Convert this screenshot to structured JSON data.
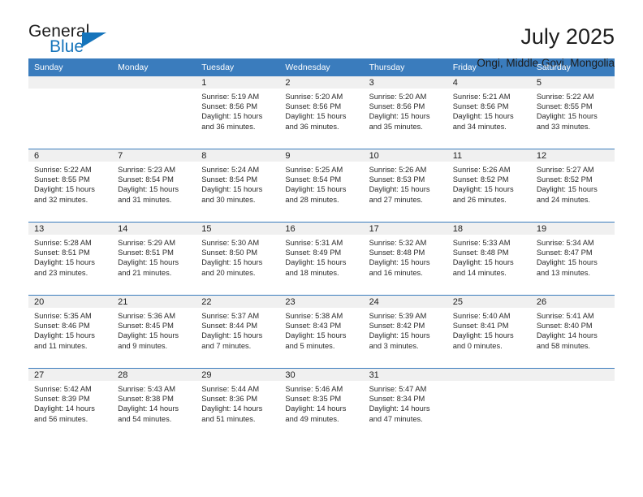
{
  "brand": {
    "name_part1": "General",
    "name_part2": "Blue"
  },
  "header": {
    "title": "July 2025",
    "subtitle": "Ongi, Middle Govi, Mongolia"
  },
  "calendar": {
    "weekday_headers": [
      "Sunday",
      "Monday",
      "Tuesday",
      "Wednesday",
      "Thursday",
      "Friday",
      "Saturday"
    ],
    "accent_color": "#3a7cbd",
    "daynum_band_color": "#f0f0f0",
    "labels": {
      "sunrise_prefix": "Sunrise: ",
      "sunset_prefix": "Sunset: ",
      "daylight_prefix": "Daylight: "
    },
    "weeks": [
      [
        {
          "day": "",
          "empty": true
        },
        {
          "day": "",
          "empty": true
        },
        {
          "day": "1",
          "sunrise": "Sunrise: 5:19 AM",
          "sunset": "Sunset: 8:56 PM",
          "daylight_l1": "Daylight: 15 hours",
          "daylight_l2": "and 36 minutes."
        },
        {
          "day": "2",
          "sunrise": "Sunrise: 5:20 AM",
          "sunset": "Sunset: 8:56 PM",
          "daylight_l1": "Daylight: 15 hours",
          "daylight_l2": "and 36 minutes."
        },
        {
          "day": "3",
          "sunrise": "Sunrise: 5:20 AM",
          "sunset": "Sunset: 8:56 PM",
          "daylight_l1": "Daylight: 15 hours",
          "daylight_l2": "and 35 minutes."
        },
        {
          "day": "4",
          "sunrise": "Sunrise: 5:21 AM",
          "sunset": "Sunset: 8:56 PM",
          "daylight_l1": "Daylight: 15 hours",
          "daylight_l2": "and 34 minutes."
        },
        {
          "day": "5",
          "sunrise": "Sunrise: 5:22 AM",
          "sunset": "Sunset: 8:55 PM",
          "daylight_l1": "Daylight: 15 hours",
          "daylight_l2": "and 33 minutes."
        }
      ],
      [
        {
          "day": "6",
          "sunrise": "Sunrise: 5:22 AM",
          "sunset": "Sunset: 8:55 PM",
          "daylight_l1": "Daylight: 15 hours",
          "daylight_l2": "and 32 minutes."
        },
        {
          "day": "7",
          "sunrise": "Sunrise: 5:23 AM",
          "sunset": "Sunset: 8:54 PM",
          "daylight_l1": "Daylight: 15 hours",
          "daylight_l2": "and 31 minutes."
        },
        {
          "day": "8",
          "sunrise": "Sunrise: 5:24 AM",
          "sunset": "Sunset: 8:54 PM",
          "daylight_l1": "Daylight: 15 hours",
          "daylight_l2": "and 30 minutes."
        },
        {
          "day": "9",
          "sunrise": "Sunrise: 5:25 AM",
          "sunset": "Sunset: 8:54 PM",
          "daylight_l1": "Daylight: 15 hours",
          "daylight_l2": "and 28 minutes."
        },
        {
          "day": "10",
          "sunrise": "Sunrise: 5:26 AM",
          "sunset": "Sunset: 8:53 PM",
          "daylight_l1": "Daylight: 15 hours",
          "daylight_l2": "and 27 minutes."
        },
        {
          "day": "11",
          "sunrise": "Sunrise: 5:26 AM",
          "sunset": "Sunset: 8:52 PM",
          "daylight_l1": "Daylight: 15 hours",
          "daylight_l2": "and 26 minutes."
        },
        {
          "day": "12",
          "sunrise": "Sunrise: 5:27 AM",
          "sunset": "Sunset: 8:52 PM",
          "daylight_l1": "Daylight: 15 hours",
          "daylight_l2": "and 24 minutes."
        }
      ],
      [
        {
          "day": "13",
          "sunrise": "Sunrise: 5:28 AM",
          "sunset": "Sunset: 8:51 PM",
          "daylight_l1": "Daylight: 15 hours",
          "daylight_l2": "and 23 minutes."
        },
        {
          "day": "14",
          "sunrise": "Sunrise: 5:29 AM",
          "sunset": "Sunset: 8:51 PM",
          "daylight_l1": "Daylight: 15 hours",
          "daylight_l2": "and 21 minutes."
        },
        {
          "day": "15",
          "sunrise": "Sunrise: 5:30 AM",
          "sunset": "Sunset: 8:50 PM",
          "daylight_l1": "Daylight: 15 hours",
          "daylight_l2": "and 20 minutes."
        },
        {
          "day": "16",
          "sunrise": "Sunrise: 5:31 AM",
          "sunset": "Sunset: 8:49 PM",
          "daylight_l1": "Daylight: 15 hours",
          "daylight_l2": "and 18 minutes."
        },
        {
          "day": "17",
          "sunrise": "Sunrise: 5:32 AM",
          "sunset": "Sunset: 8:48 PM",
          "daylight_l1": "Daylight: 15 hours",
          "daylight_l2": "and 16 minutes."
        },
        {
          "day": "18",
          "sunrise": "Sunrise: 5:33 AM",
          "sunset": "Sunset: 8:48 PM",
          "daylight_l1": "Daylight: 15 hours",
          "daylight_l2": "and 14 minutes."
        },
        {
          "day": "19",
          "sunrise": "Sunrise: 5:34 AM",
          "sunset": "Sunset: 8:47 PM",
          "daylight_l1": "Daylight: 15 hours",
          "daylight_l2": "and 13 minutes."
        }
      ],
      [
        {
          "day": "20",
          "sunrise": "Sunrise: 5:35 AM",
          "sunset": "Sunset: 8:46 PM",
          "daylight_l1": "Daylight: 15 hours",
          "daylight_l2": "and 11 minutes."
        },
        {
          "day": "21",
          "sunrise": "Sunrise: 5:36 AM",
          "sunset": "Sunset: 8:45 PM",
          "daylight_l1": "Daylight: 15 hours",
          "daylight_l2": "and 9 minutes."
        },
        {
          "day": "22",
          "sunrise": "Sunrise: 5:37 AM",
          "sunset": "Sunset: 8:44 PM",
          "daylight_l1": "Daylight: 15 hours",
          "daylight_l2": "and 7 minutes."
        },
        {
          "day": "23",
          "sunrise": "Sunrise: 5:38 AM",
          "sunset": "Sunset: 8:43 PM",
          "daylight_l1": "Daylight: 15 hours",
          "daylight_l2": "and 5 minutes."
        },
        {
          "day": "24",
          "sunrise": "Sunrise: 5:39 AM",
          "sunset": "Sunset: 8:42 PM",
          "daylight_l1": "Daylight: 15 hours",
          "daylight_l2": "and 3 minutes."
        },
        {
          "day": "25",
          "sunrise": "Sunrise: 5:40 AM",
          "sunset": "Sunset: 8:41 PM",
          "daylight_l1": "Daylight: 15 hours",
          "daylight_l2": "and 0 minutes."
        },
        {
          "day": "26",
          "sunrise": "Sunrise: 5:41 AM",
          "sunset": "Sunset: 8:40 PM",
          "daylight_l1": "Daylight: 14 hours",
          "daylight_l2": "and 58 minutes."
        }
      ],
      [
        {
          "day": "27",
          "sunrise": "Sunrise: 5:42 AM",
          "sunset": "Sunset: 8:39 PM",
          "daylight_l1": "Daylight: 14 hours",
          "daylight_l2": "and 56 minutes."
        },
        {
          "day": "28",
          "sunrise": "Sunrise: 5:43 AM",
          "sunset": "Sunset: 8:38 PM",
          "daylight_l1": "Daylight: 14 hours",
          "daylight_l2": "and 54 minutes."
        },
        {
          "day": "29",
          "sunrise": "Sunrise: 5:44 AM",
          "sunset": "Sunset: 8:36 PM",
          "daylight_l1": "Daylight: 14 hours",
          "daylight_l2": "and 51 minutes."
        },
        {
          "day": "30",
          "sunrise": "Sunrise: 5:46 AM",
          "sunset": "Sunset: 8:35 PM",
          "daylight_l1": "Daylight: 14 hours",
          "daylight_l2": "and 49 minutes."
        },
        {
          "day": "31",
          "sunrise": "Sunrise: 5:47 AM",
          "sunset": "Sunset: 8:34 PM",
          "daylight_l1": "Daylight: 14 hours",
          "daylight_l2": "and 47 minutes."
        },
        {
          "day": "",
          "empty": true
        },
        {
          "day": "",
          "empty": true
        }
      ]
    ]
  }
}
